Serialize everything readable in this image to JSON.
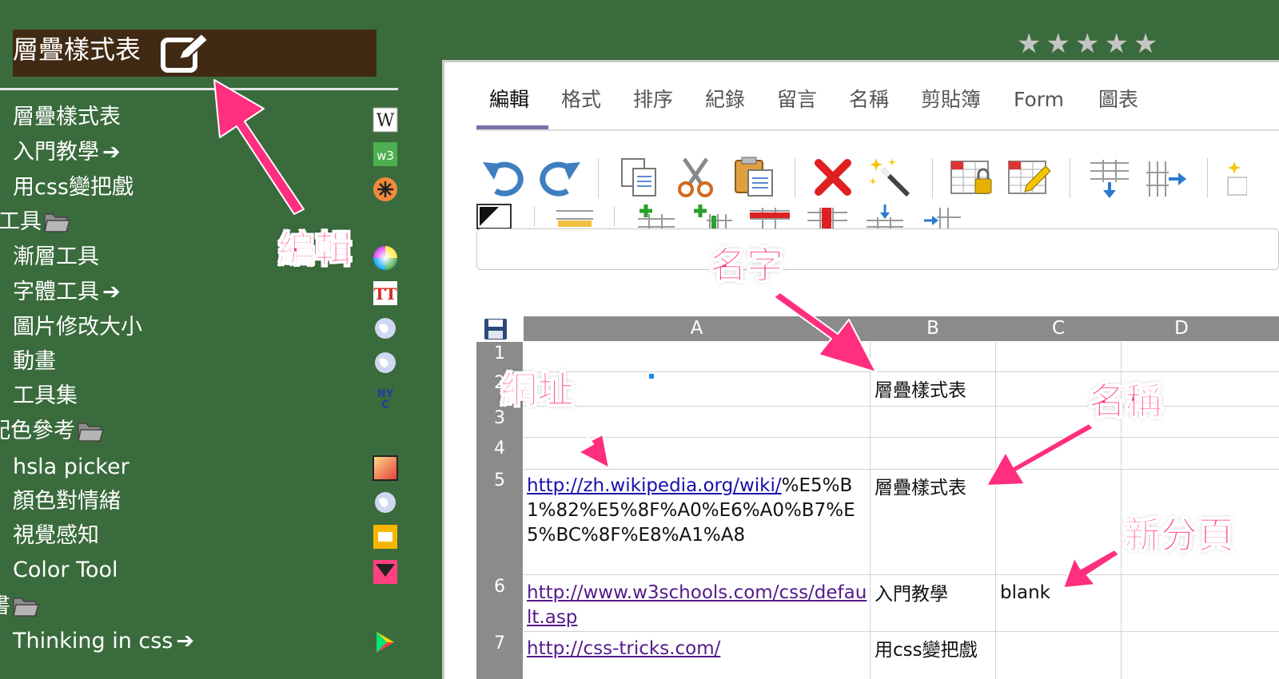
{
  "sidebar": {
    "title": "層疊樣式表",
    "items": [
      {
        "label": "層疊樣式表",
        "arrow": "",
        "icon": "wikipedia-icon"
      },
      {
        "label": "入門教學",
        "arrow": "➔",
        "icon": "w3schools-icon"
      },
      {
        "label": "用css變把戲",
        "arrow": "",
        "icon": "css-tricks-icon"
      },
      {
        "label": "工具",
        "folder": true
      },
      {
        "label": "漸層工具",
        "arrow": "",
        "icon": "color-wheel-icon"
      },
      {
        "label": "字體工具",
        "arrow": "➔",
        "icon": "font-tool-icon"
      },
      {
        "label": "圖片修改大小",
        "arrow": "",
        "icon": "globe-icon"
      },
      {
        "label": "動畫",
        "arrow": "",
        "icon": "globe-icon"
      },
      {
        "label": "工具集",
        "arrow": "",
        "icon": "toolset-icon"
      },
      {
        "label": "配色參考",
        "folder": true
      },
      {
        "label": "hsla picker",
        "arrow": "",
        "icon": "gradient-square-icon"
      },
      {
        "label": "顏色對情緒",
        "arrow": "",
        "icon": "globe-icon"
      },
      {
        "label": "視覺感知",
        "arrow": "",
        "icon": "yellow-box-icon"
      },
      {
        "label": "Color Tool",
        "arrow": "",
        "icon": "color-tool-icon"
      },
      {
        "label": "書",
        "folder": true
      },
      {
        "label": "Thinking in css",
        "arrow": "➔",
        "icon": "play-store-icon"
      }
    ]
  },
  "rating": "★★★★★",
  "tabs": [
    "編輯",
    "格式",
    "排序",
    "紀錄",
    "留言",
    "名稱",
    "剪貼簿",
    "Form",
    "圖表"
  ],
  "sheet": {
    "columns": [
      "A",
      "B",
      "C",
      "D"
    ],
    "rows": [
      "1",
      "2",
      "3",
      "4",
      "5",
      "6",
      "7"
    ],
    "cells": {
      "b2": "層疊樣式表",
      "a5_link": "http://zh.wikipedia.org/wiki/",
      "a5_rest": "%E5%B1%82%E5%8F%A0%E6%A0%B7%E5%BC%8F%E8%A1%A8",
      "b5": "層疊樣式表",
      "a6_link": "http://www.w3schools.com/css/default.asp",
      "b6": "入門教學",
      "c6": "blank",
      "a7_link": "http://css-tricks.com/",
      "b7": "用css變把戲"
    }
  },
  "annotations": {
    "edit": "編輯",
    "name_char": "名字",
    "url": "網址",
    "name": "名稱",
    "new_tab": "新分頁"
  },
  "colors": {
    "background": "#3a6b3c",
    "title_bg": "#412a14",
    "annotation": "#ff2e7e",
    "tab_underline": "#7b6fa8"
  }
}
